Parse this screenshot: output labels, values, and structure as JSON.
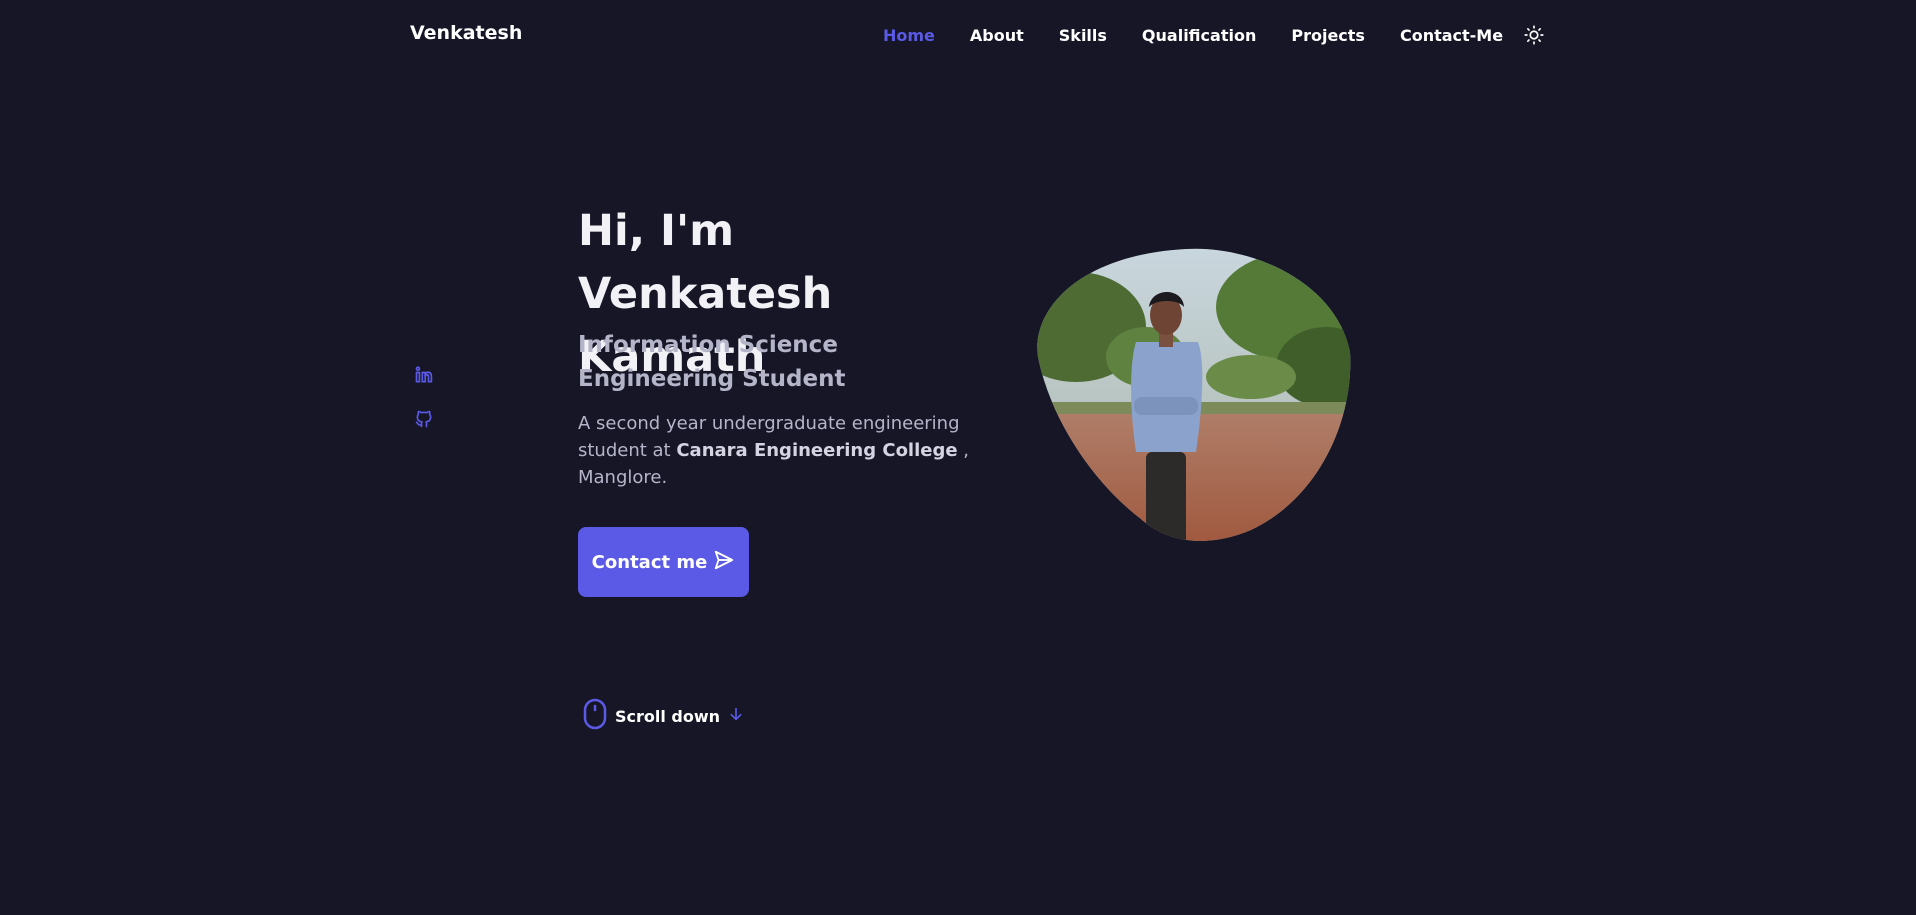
{
  "header": {
    "logo": "Venkatesh",
    "nav": [
      {
        "label": "Home",
        "active": true
      },
      {
        "label": "About"
      },
      {
        "label": "Skills"
      },
      {
        "label": "Qualification"
      },
      {
        "label": "Projects"
      },
      {
        "label": "Contact-Me"
      }
    ],
    "theme_icon": "sun-icon"
  },
  "social": {
    "icons": [
      "linkedin-icon",
      "github-icon"
    ]
  },
  "hero": {
    "title": "Hi, I'm Venkatesh Kamath",
    "subtitle": "Information Science Engineering Student",
    "description_prefix": "A second year undergraduate engineering student at ",
    "college": "Canara Engineering College",
    "description_suffix": " , Manglore.",
    "contact_label": "Contact me",
    "image_icon": "profile-photo"
  },
  "scroll": {
    "label": "Scroll down",
    "icons": [
      "mouse-icon",
      "arrow-down-icon"
    ]
  },
  "colors": {
    "background": "#161627",
    "accent": "#5a5ae6",
    "text": "#ffffff",
    "muted": "#b5b5c9"
  }
}
